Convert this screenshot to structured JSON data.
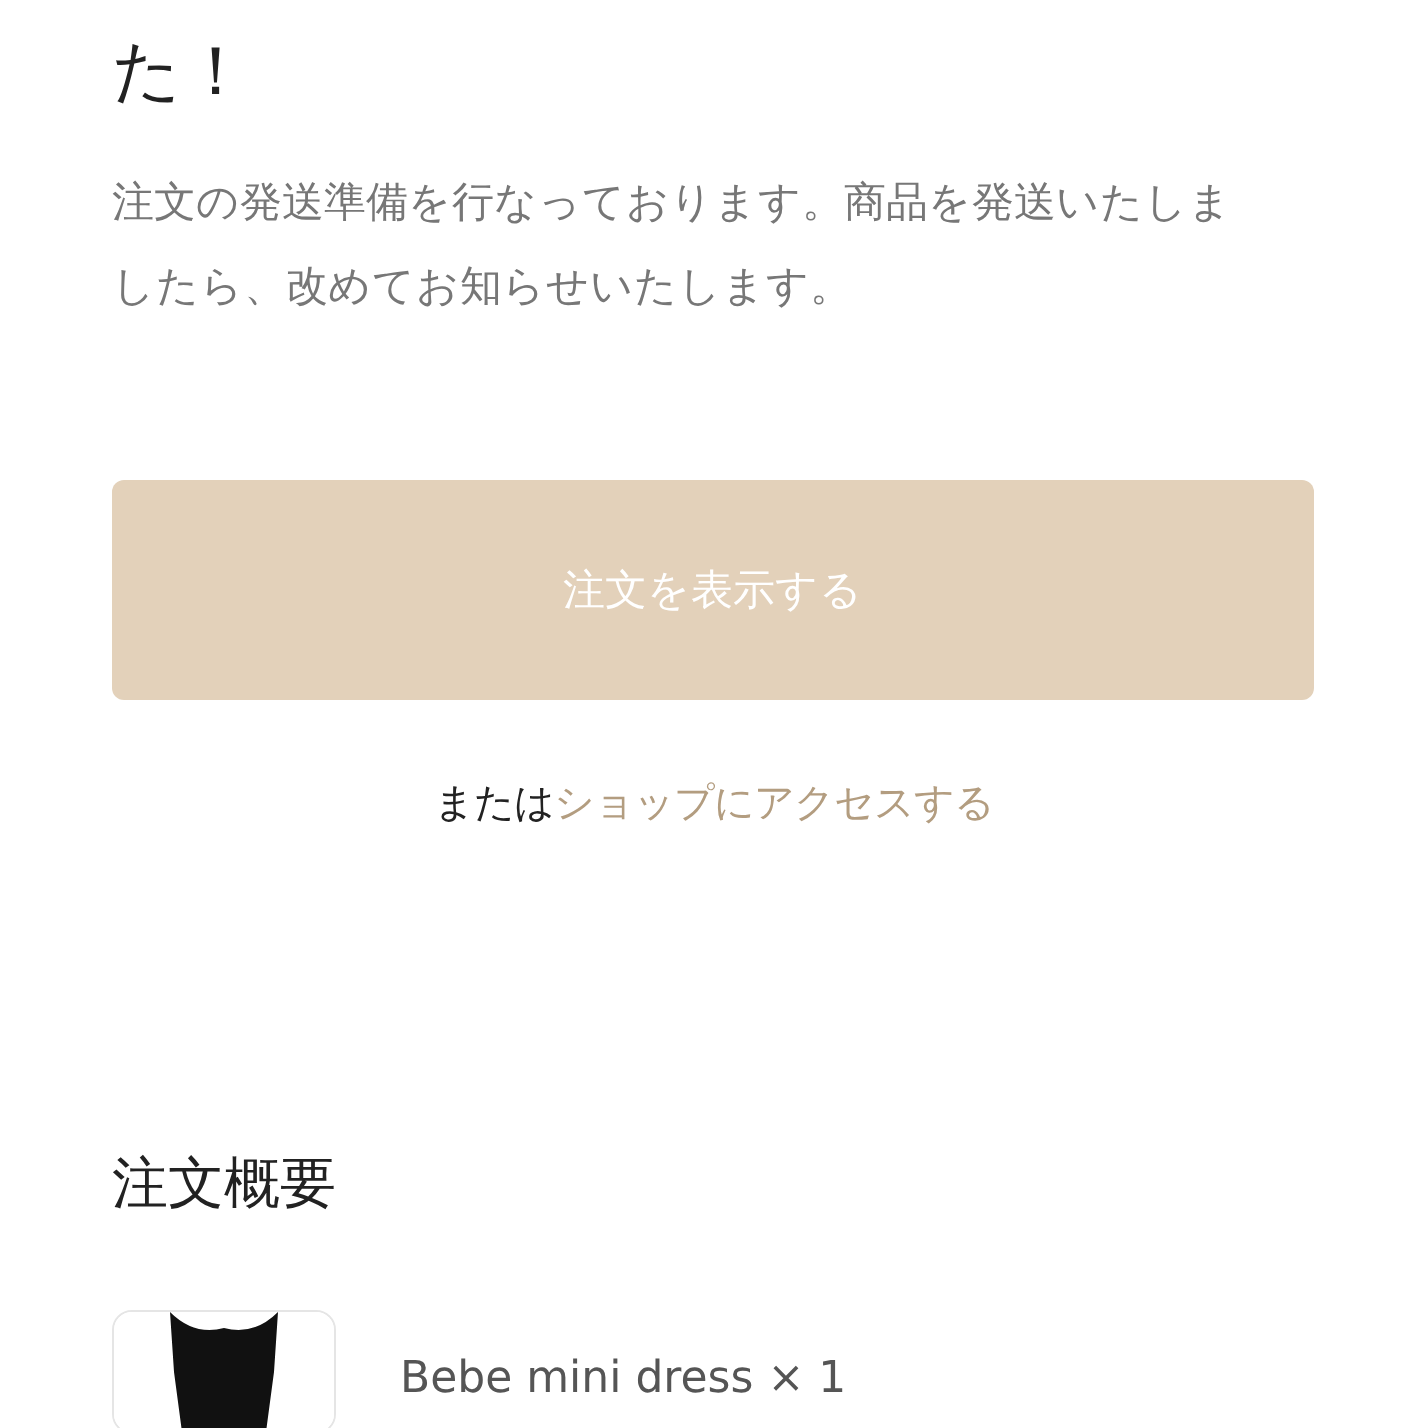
{
  "heading": "た！",
  "message": "注文の発送準備を行なっております。商品を発送いたしましたら、改めてお知らせいたします。",
  "view_order_button": "注文を表示する",
  "shop_link": {
    "prefix": "または",
    "link": "ショップにアクセスする"
  },
  "summary": {
    "title": "注文概要",
    "items": [
      {
        "name": "Bebe mini dress × 1"
      }
    ]
  }
}
